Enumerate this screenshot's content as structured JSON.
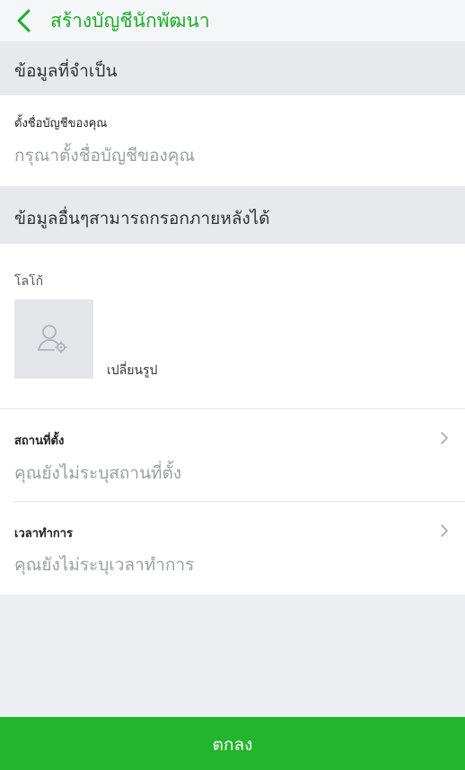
{
  "header": {
    "title": "สร้างบัญชีนักพัฒนา",
    "back_icon": "chevron-left-icon",
    "accent_color": "#1aae2a"
  },
  "required_section": {
    "title": "ข้อมูลที่จำเป็น",
    "account_name": {
      "label": "ตั้งชื่อบัญชีของคุณ",
      "placeholder": "กรุณาตั้งชื่อบัญชีของคุณ"
    }
  },
  "optional_section": {
    "title": "ข้อมูลอื่นๆสามารถกรอกภายหลังได้",
    "logo": {
      "label": "โลโก้",
      "icon": "user-settings-icon",
      "change_label": "เปลี่ยนรูป"
    },
    "location": {
      "label": "สถานที่ตั้ง",
      "placeholder": "คุณยังไม่ระบุสถานที่ตั้ง",
      "icon": "chevron-right-icon"
    },
    "business_hours": {
      "label": "เวลาทำการ",
      "placeholder": "คุณยังไม่ระบุเวลาทำการ",
      "icon": "chevron-right-icon"
    }
  },
  "footer": {
    "ok_label": "ตกลง",
    "button_color": "#22b52d"
  }
}
